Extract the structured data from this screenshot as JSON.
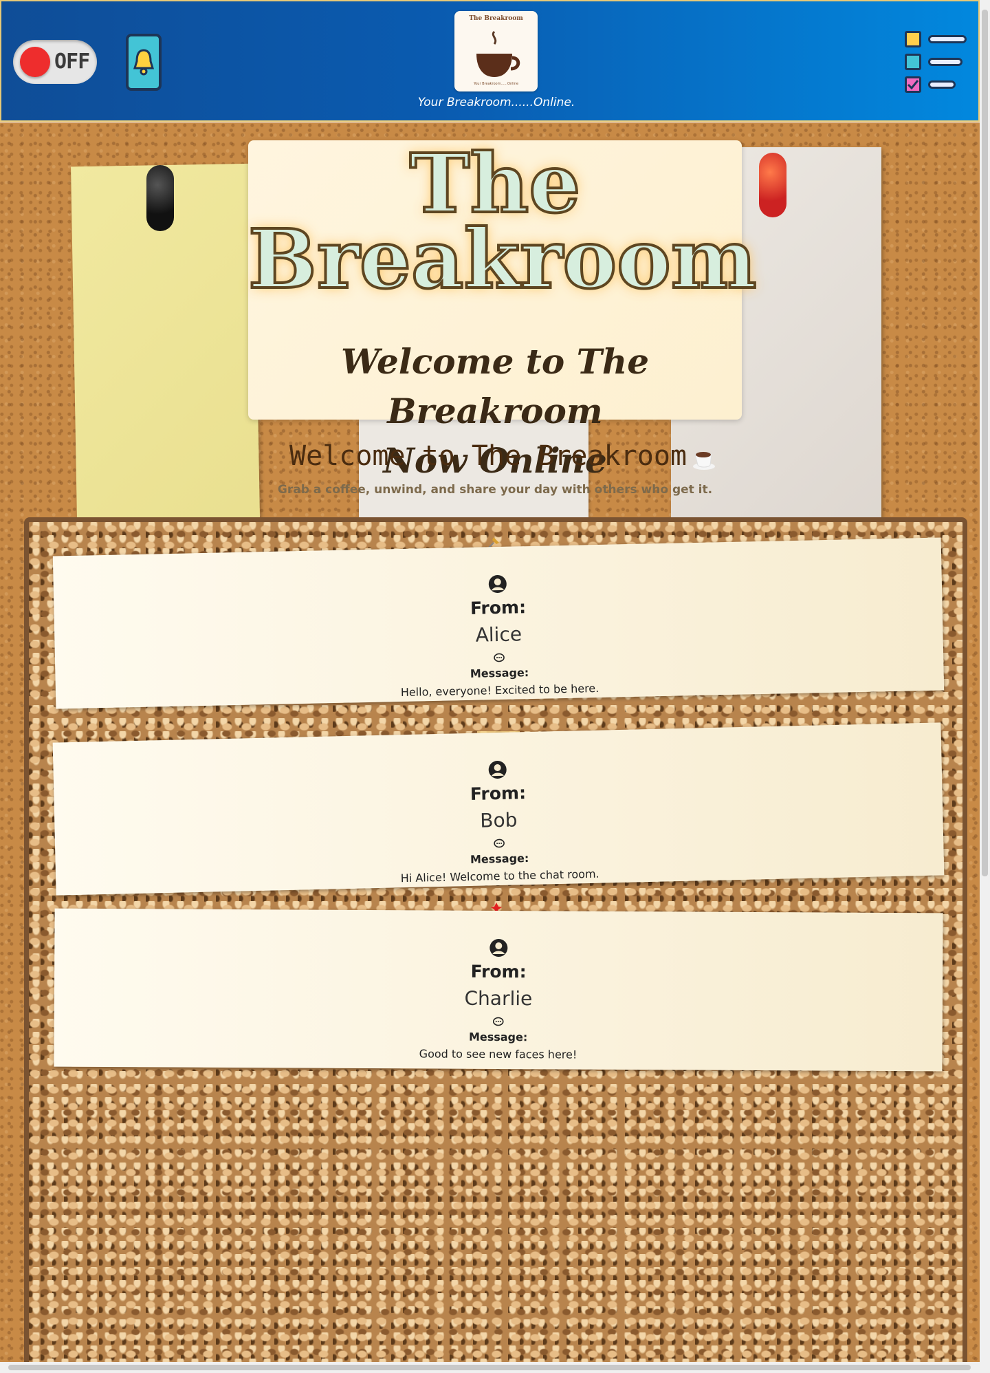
{
  "header": {
    "toggle_label": "OFF",
    "logo_arc": "The Breakroom",
    "logo_sub": "Your Breakroom......Online",
    "tagline": "Your Breakroom......Online."
  },
  "hero": {
    "title_line1": "The",
    "title_line2": "Breakroom",
    "welcome_line1": "Welcome to The Breakroom",
    "welcome_line2": "Now Online"
  },
  "intro": {
    "heading": "Welcome to The Breakroom",
    "subtitle": "Grab a coffee, unwind, and share your day with others who get it."
  },
  "messages": [
    {
      "from_label": "From:",
      "name": "Alice",
      "message_label": "Message:",
      "text": "Hello, everyone! Excited to be here."
    },
    {
      "from_label": "From:",
      "name": "Bob",
      "message_label": "Message:",
      "text": "Hi Alice! Welcome to the chat room."
    },
    {
      "from_label": "From:",
      "name": "Charlie",
      "message_label": "Message:",
      "text": "Good to see new faces here!"
    }
  ],
  "icons": {
    "toggle": "power-toggle-icon",
    "notifications": "bell-icon",
    "menu": "checklist-menu-icon",
    "user": "user-circle-icon",
    "chat": "chat-bubble-icon",
    "cup": "coffee-cup-icon"
  },
  "colors": {
    "header_start": "#0f4d97",
    "header_end": "#0288de",
    "toggle_off": "#ee2d2d",
    "cork": "#c88a46",
    "note_bg": "#fffbef"
  }
}
